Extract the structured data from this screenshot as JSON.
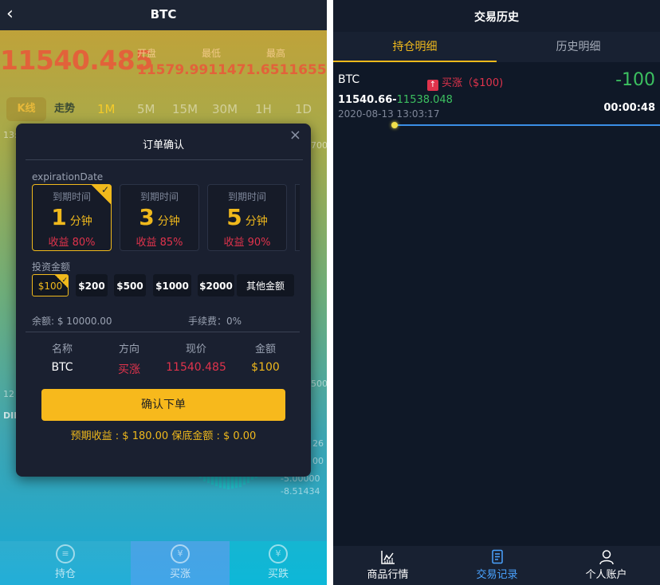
{
  "left": {
    "header": {
      "back_icon": "chevron-left-icon",
      "title": "BTC"
    },
    "price": "11540.485",
    "stats": {
      "open_label": "开盘",
      "low_label": "最低",
      "high_label": "最高",
      "values_text": "11579.9911471.6511655.41"
    },
    "chart_tabs": [
      "K线",
      "走势",
      "1M",
      "5M",
      "15M",
      "30M",
      "1H",
      "1D"
    ],
    "axis": {
      "time": "13:",
      "diff": "DIF",
      "r1": "700",
      "r2": "12",
      "r3": "26",
      "r4": "00",
      "r5": "-5.00000",
      "r6": "-8.51434",
      "r7": "500"
    },
    "bottom_tabs": [
      {
        "label": "持仓",
        "icon": "coins-icon"
      },
      {
        "label": "买涨",
        "icon": "yen-icon"
      },
      {
        "label": "买跌",
        "icon": "yen-icon"
      }
    ],
    "modal": {
      "title": "订单确认",
      "close_icon": "close-icon",
      "expiration_label": "expirationDate",
      "time_options": [
        {
          "caption": "到期时间",
          "num": "1",
          "unit": "分钟",
          "profit": "收益 80%",
          "selected": true
        },
        {
          "caption": "到期时间",
          "num": "3",
          "unit": "分钟",
          "profit": "收益 85%",
          "selected": false
        },
        {
          "caption": "到期时间",
          "num": "5",
          "unit": "分钟",
          "profit": "收益 90%",
          "selected": false
        }
      ],
      "amount_label": "投资金额",
      "amounts": [
        "$100",
        "$200",
        "$500",
        "$1000",
        "$2000",
        "其他金额"
      ],
      "selected_amount": "$100",
      "balance": "余额: $ 10000.00",
      "fee": "手续费：0%",
      "table_headers": [
        "名称",
        "方向",
        "现价",
        "金额"
      ],
      "table_values": [
        "BTC",
        "买涨",
        "11540.485",
        "$100"
      ],
      "confirm_label": "确认下单",
      "expect_text": "预期收益 : $ 180.00    保底金额 : $ 0.00"
    }
  },
  "right": {
    "title": "交易历史",
    "tabs": [
      "持仓明细",
      "历史明细"
    ],
    "position": {
      "name": "BTC",
      "direction": "买涨（$100)",
      "pl": "-100",
      "open_price": "11540.66-",
      "current_price": "11538.048",
      "date": "2020-08-13 13:03:17",
      "countdown": "00:00:48"
    },
    "bottom_tabs": [
      {
        "label": "商品行情",
        "icon": "chart-icon"
      },
      {
        "label": "交易记录",
        "icon": "document-icon"
      },
      {
        "label": "个人账户",
        "icon": "user-icon"
      }
    ]
  },
  "colors": {
    "accent": "#f0b91c",
    "up": "#e0334c",
    "profit": "#3cc060",
    "active_tab": "#4aa3ff"
  }
}
